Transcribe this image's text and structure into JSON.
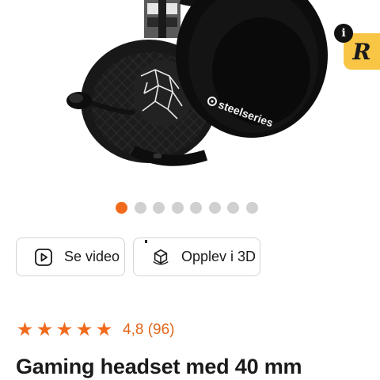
{
  "product_image": {
    "alt": "SteelSeries gaming headset",
    "brand_on_ear": "steelseries"
  },
  "info_badge": {
    "info_glyph": "i",
    "letter": "R",
    "color": "#f8c545"
  },
  "carousel": {
    "total": 8,
    "active_index": 0,
    "active_color": "#f26b1d"
  },
  "buttons": {
    "video_label": "Se video",
    "view3d_label": "Opplev i 3D"
  },
  "rating": {
    "stars": 5,
    "value_text": "4,8 (96)",
    "color": "#f26b1d"
  },
  "title": "Gaming headset med 40 mm"
}
